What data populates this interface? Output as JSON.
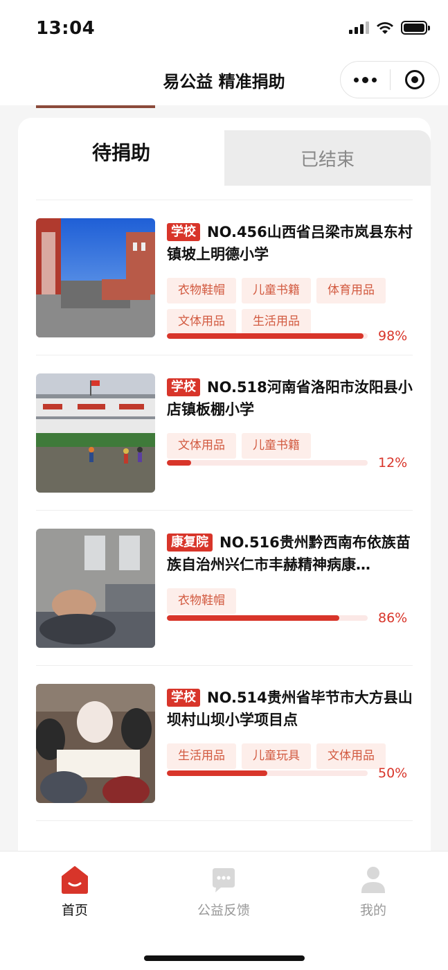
{
  "status_bar": {
    "time": "13:04"
  },
  "nav": {
    "title": "易公益 精准捐助"
  },
  "tabs": {
    "active": "待捐助",
    "inactive": "已结束"
  },
  "items": [
    {
      "badge": "学校",
      "title": "NO.456山西省吕梁市岚县东村镇坡上明德小学",
      "tags": [
        "衣物鞋帽",
        "儿童书籍",
        "体育用品",
        "文体用品",
        "生活用品"
      ],
      "progress": 98,
      "progress_label": "98%"
    },
    {
      "badge": "学校",
      "title": "NO.518河南省洛阳市汝阳县小店镇板棚小学",
      "tags": [
        "文体用品",
        "儿童书籍"
      ],
      "progress": 12,
      "progress_label": "12%"
    },
    {
      "badge": "康复院",
      "title": "NO.516贵州黔西南布依族苗族自治州兴仁市丰赫精神病康…",
      "tags": [
        "衣物鞋帽"
      ],
      "progress": 86,
      "progress_label": "86%"
    },
    {
      "badge": "学校",
      "title": "NO.514贵州省毕节市大方县山坝村山坝小学项目点",
      "tags": [
        "生活用品",
        "儿童玩具",
        "文体用品"
      ],
      "progress": 50,
      "progress_label": "50%"
    }
  ],
  "tabbar": {
    "home": "首页",
    "feedback": "公益反馈",
    "mine": "我的"
  },
  "colors": {
    "accent": "#d8352a",
    "tag_bg": "#fdeeea",
    "tag_text": "#d25a40"
  }
}
